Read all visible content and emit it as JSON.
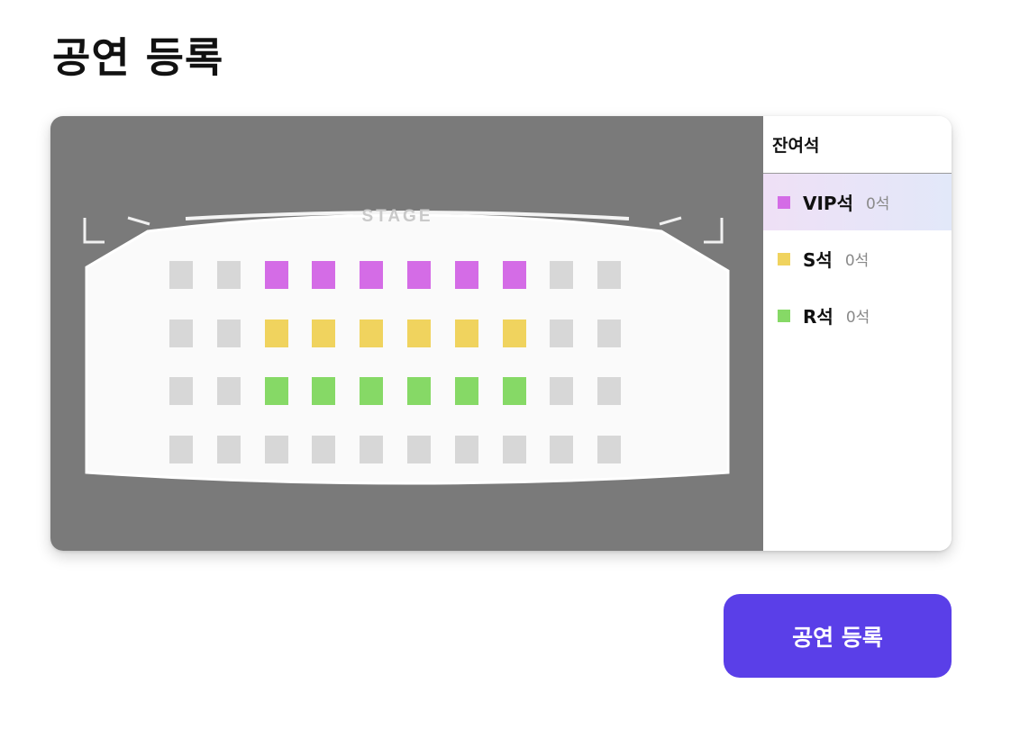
{
  "page": {
    "title": "공연 등록"
  },
  "seat_map": {
    "stage_label": "STAGE",
    "rows": [
      [
        "empty",
        "empty",
        "vip",
        "vip",
        "vip",
        "vip",
        "vip",
        "vip",
        "empty",
        "empty"
      ],
      [
        "empty",
        "empty",
        "s",
        "s",
        "s",
        "s",
        "s",
        "s",
        "empty",
        "empty"
      ],
      [
        "empty",
        "empty",
        "r",
        "r",
        "r",
        "r",
        "r",
        "r",
        "empty",
        "empty"
      ],
      [
        "empty",
        "empty",
        "empty",
        "empty",
        "empty",
        "empty",
        "empty",
        "empty",
        "empty",
        "empty"
      ]
    ],
    "colors": {
      "vip": "#d46ce6",
      "s": "#f0d35e",
      "r": "#86d966",
      "empty": "#d7d7d7",
      "background": "#7a7a7a"
    }
  },
  "remaining_panel": {
    "title": "잔여석",
    "grades": [
      {
        "name": "VIP석",
        "count": "0석",
        "color": "#d46ce6",
        "selected": true
      },
      {
        "name": "S석",
        "count": "0석",
        "color": "#f0d35e",
        "selected": false
      },
      {
        "name": "R석",
        "count": "0석",
        "color": "#86d966",
        "selected": false
      }
    ]
  },
  "actions": {
    "register_label": "공연 등록",
    "accent": "#5a3fe8"
  }
}
